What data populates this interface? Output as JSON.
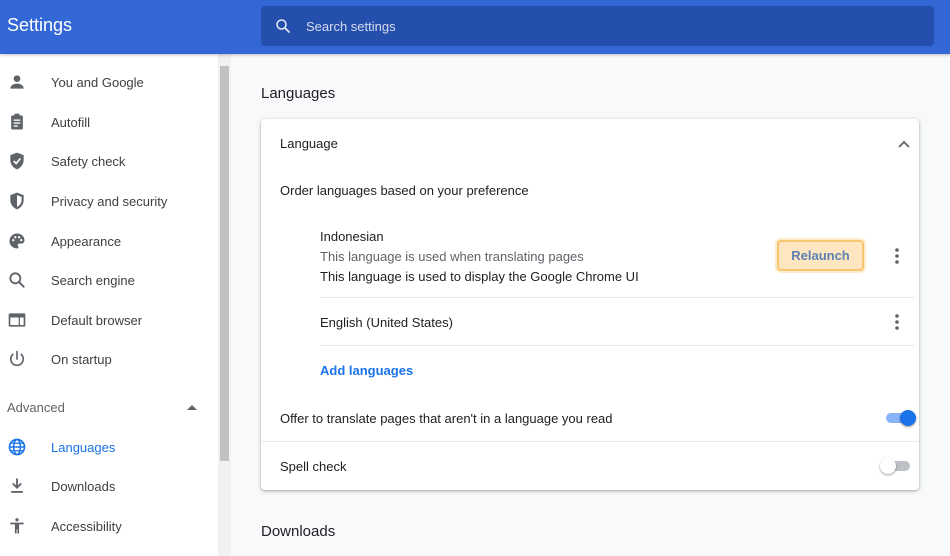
{
  "header": {
    "title": "Settings",
    "search_placeholder": "Search settings"
  },
  "sidebar": {
    "items": [
      {
        "label": "You and Google",
        "icon": "person-icon"
      },
      {
        "label": "Autofill",
        "icon": "clipboard-icon"
      },
      {
        "label": "Safety check",
        "icon": "shield-check-icon"
      },
      {
        "label": "Privacy and security",
        "icon": "shield-icon"
      },
      {
        "label": "Appearance",
        "icon": "palette-icon"
      },
      {
        "label": "Search engine",
        "icon": "search-icon"
      },
      {
        "label": "Default browser",
        "icon": "browser-icon"
      },
      {
        "label": "On startup",
        "icon": "power-icon"
      }
    ],
    "advanced_label": "Advanced",
    "advanced_items": [
      {
        "label": "Languages",
        "icon": "globe-icon",
        "active": true
      },
      {
        "label": "Downloads",
        "icon": "download-icon"
      },
      {
        "label": "Accessibility",
        "icon": "accessibility-icon"
      }
    ]
  },
  "main": {
    "section_title": "Languages",
    "language_card": {
      "header": "Language",
      "order_text": "Order languages based on your preference",
      "languages": [
        {
          "name": "Indonesian",
          "line1": "This language is used when translating pages",
          "line2": "This language is used to display the Google Chrome UI",
          "button": "Relaunch"
        },
        {
          "name": "English (United States)"
        }
      ],
      "add_languages": "Add languages"
    },
    "translate_offer": {
      "label": "Offer to translate pages that aren't in a language you read",
      "enabled": true
    },
    "spell_check": {
      "label": "Spell check",
      "enabled": false
    },
    "next_section_title": "Downloads"
  },
  "colors": {
    "header_bg": "#3367d6",
    "search_bg": "#254fac",
    "accent": "#1a73e8",
    "relaunch_bg": "#fde6c0",
    "relaunch_border": "#f7c66e"
  }
}
